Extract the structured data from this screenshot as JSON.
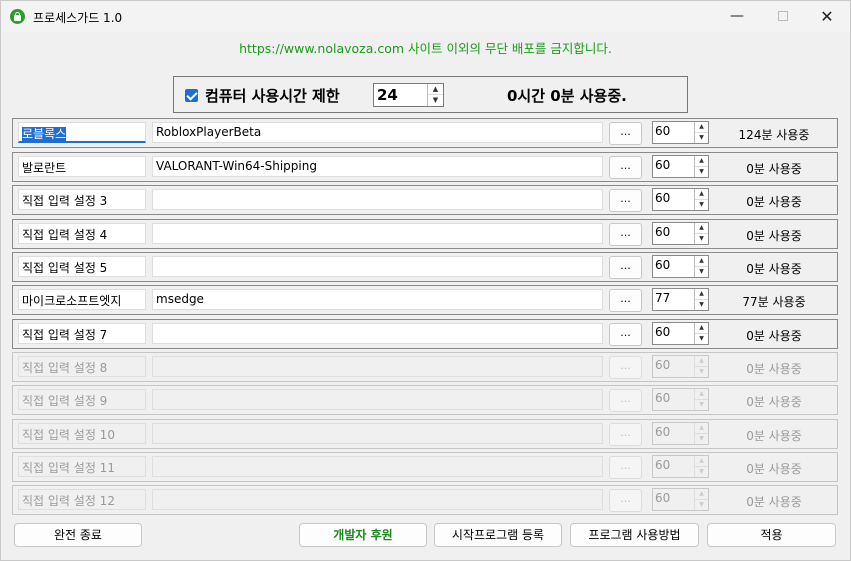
{
  "window": {
    "title": "프로세스가드 1.0",
    "minimize": "—",
    "close": "✕"
  },
  "notice": "https://www.nolavoza.com 사이트 이외의 무단 배포를 금지합니다.",
  "limit": {
    "checked": true,
    "label": "컴퓨터 사용시간 제한",
    "hours": "24",
    "usage": "0시간 0분 사용중."
  },
  "browse_label": "...",
  "rows": [
    {
      "name": "로블록스",
      "process": "RobloxPlayerBeta",
      "minutes": "60",
      "usage": "124분 사용중"
    },
    {
      "name": "발로란트",
      "process": "VALORANT-Win64-Shipping",
      "minutes": "60",
      "usage": "0분 사용중"
    },
    {
      "name": "직접 입력 설정 3",
      "process": "",
      "minutes": "60",
      "usage": "0분 사용중"
    },
    {
      "name": "직접 입력 설정 4",
      "process": "",
      "minutes": "60",
      "usage": "0분 사용중"
    },
    {
      "name": "직접 입력 설정 5",
      "process": "",
      "minutes": "60",
      "usage": "0분 사용중"
    },
    {
      "name": "마이크로소프트엣지",
      "process": "msedge",
      "minutes": "77",
      "usage": "77분 사용중"
    },
    {
      "name": "직접 입력 설정 7",
      "process": "",
      "minutes": "60",
      "usage": "0분 사용중"
    },
    {
      "name": "직접 입력 설정 8",
      "process": "",
      "minutes": "60",
      "usage": "0분 사용중"
    },
    {
      "name": "직접 입력 설정 9",
      "process": "",
      "minutes": "60",
      "usage": "0분 사용중"
    },
    {
      "name": "직접 입력 설정 10",
      "process": "",
      "minutes": "60",
      "usage": "0분 사용중"
    },
    {
      "name": "직접 입력 설정 11",
      "process": "",
      "minutes": "60",
      "usage": "0분 사용중"
    },
    {
      "name": "직접 입력 설정 12",
      "process": "",
      "minutes": "60",
      "usage": "0분 사용중"
    }
  ],
  "buttons": {
    "exit": "완전 종료",
    "support": "개발자 후원",
    "startup": "시작프로그램 등록",
    "howto": "프로그램 사용방법",
    "apply": "적용"
  }
}
